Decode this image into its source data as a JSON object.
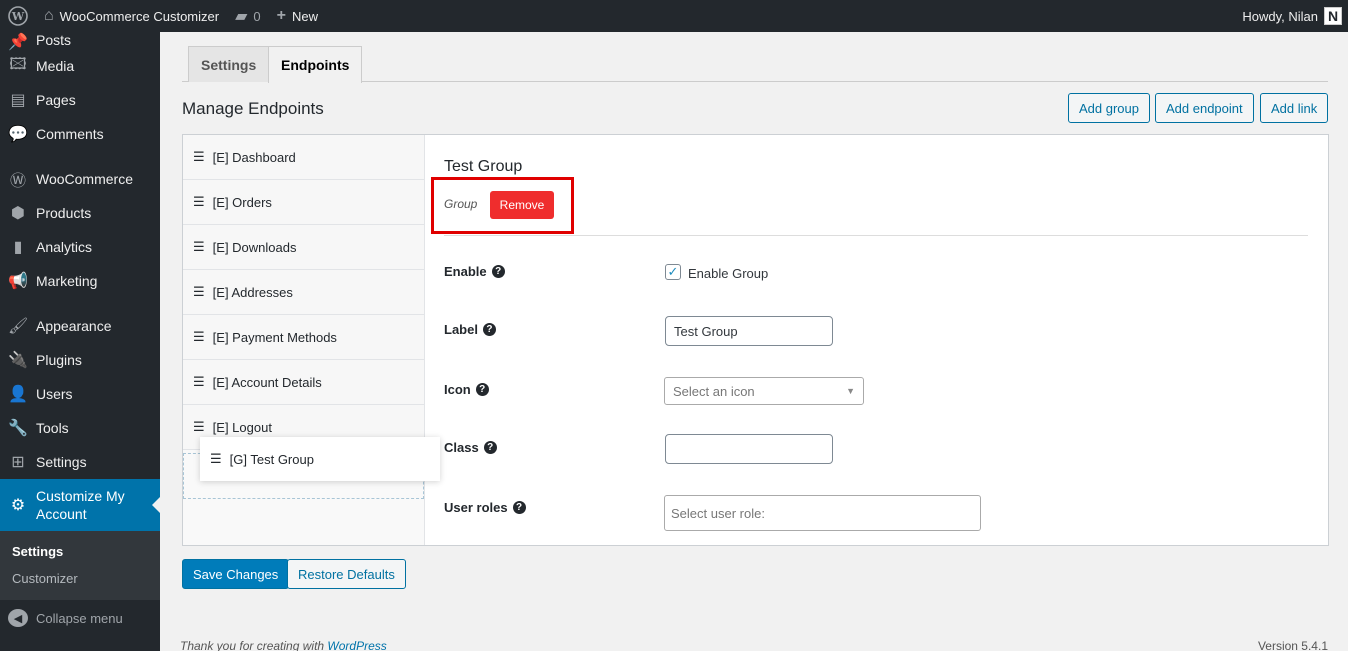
{
  "adminbar": {
    "site_name": "WooCommerce Customizer",
    "comments_count": "0",
    "new_label": "New",
    "howdy": "Howdy, Nilan",
    "avatar_letter": "N"
  },
  "sidebar": {
    "items": [
      {
        "label": "Posts",
        "icon": "📌"
      },
      {
        "label": "Media",
        "icon": "🖾"
      },
      {
        "label": "Pages",
        "icon": "▤"
      },
      {
        "label": "Comments",
        "icon": "💬"
      },
      {
        "label": "WooCommerce",
        "icon": "Ⓦ"
      },
      {
        "label": "Products",
        "icon": "⬢"
      },
      {
        "label": "Analytics",
        "icon": "▮"
      },
      {
        "label": "Marketing",
        "icon": "📢"
      },
      {
        "label": "Appearance",
        "icon": "🖌"
      },
      {
        "label": "Plugins",
        "icon": "🔌"
      },
      {
        "label": "Users",
        "icon": "👤"
      },
      {
        "label": "Tools",
        "icon": "🔧"
      },
      {
        "label": "Settings",
        "icon": "⊞"
      }
    ],
    "current": {
      "label": "Customize My Account",
      "icon": "⚙"
    },
    "submenu": [
      "Settings",
      "Customizer"
    ],
    "collapse_label": "Collapse menu"
  },
  "tabs": [
    "Settings",
    "Endpoints"
  ],
  "manage_title": "Manage Endpoints",
  "actions": {
    "add_group": "Add group",
    "add_endpoint": "Add endpoint",
    "add_link": "Add link"
  },
  "endpoints": [
    "[E] Dashboard",
    "[E] Orders",
    "[E] Downloads",
    "[E] Addresses",
    "[E] Payment Methods",
    "[E] Account Details",
    "[E] Logout"
  ],
  "dragging_item": "[G] Test Group",
  "detail": {
    "title": "Test Group",
    "type_label": "Group",
    "remove_label": "Remove",
    "enable_label": "Enable",
    "enable_checkbox_label": "Enable Group",
    "enable_checked": true,
    "label_label": "Label",
    "label_value": "Test Group",
    "icon_label": "Icon",
    "icon_placeholder": "Select an icon",
    "class_label": "Class",
    "class_value": "",
    "roles_label": "User roles",
    "roles_placeholder": "Select user role:"
  },
  "buttons": {
    "save": "Save Changes",
    "restore": "Restore Defaults"
  },
  "footer": {
    "thanks_prefix": "Thank you for creating with ",
    "wp_link": "WordPress",
    "version": "Version 5.4.1"
  }
}
